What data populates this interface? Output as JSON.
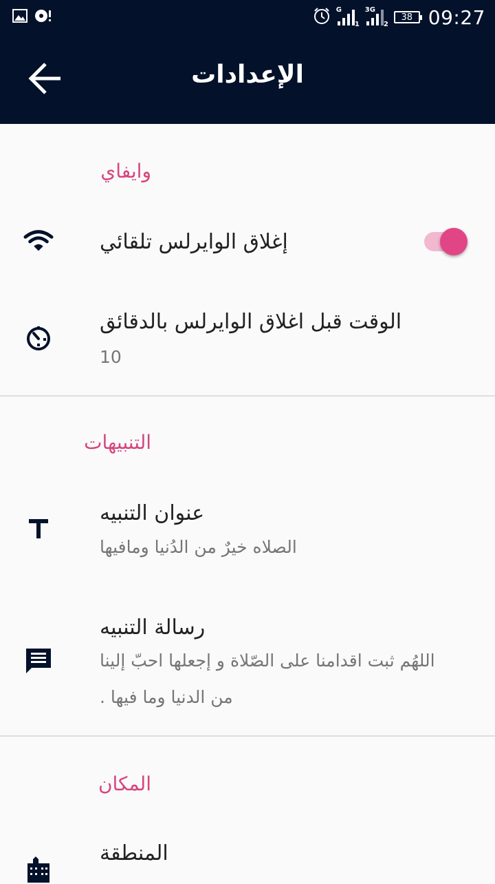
{
  "status_bar": {
    "time": "09:27",
    "battery": "38",
    "sim1_network": "G",
    "sim1_slot": "1",
    "sim2_network": "3G",
    "sim2_slot": "2",
    "icons": [
      "image-icon",
      "media-icon",
      "alarm-icon",
      "signal-icon",
      "battery-icon"
    ]
  },
  "app_bar": {
    "title": "الإعدادات",
    "back_icon": "arrow-back-icon"
  },
  "sections": {
    "wifi": {
      "title": "وايفاي",
      "auto_close": {
        "title": "إغلاق الوايرلس تلقائي",
        "icon": "wifi-icon",
        "enabled": true
      },
      "close_delay": {
        "title": "الوقت قبل اغلاق الوايرلس بالدقائق",
        "value": "10",
        "icon": "timer-icon"
      }
    },
    "notifications": {
      "title": "التنبيهات",
      "notif_title": {
        "title": "عنوان التنبيه",
        "value": "الصلاه خيرٌ من الدُنيا ومافيها",
        "icon": "text-icon"
      },
      "notif_message": {
        "title": "رسالة التنبيه",
        "value_line1": "اللهُم ثبت اقدامنا على الصّلاة و إجعلها احبّ إلينا",
        "value_line2": "من الدنيا وما فيها .",
        "icon": "message-icon"
      }
    },
    "location": {
      "title": "المكان",
      "region": {
        "title": "المنطقة",
        "icon": "city-icon"
      }
    }
  },
  "colors": {
    "primary_dark": "#03112a",
    "accent": "#e24585",
    "section_title": "#d6457e",
    "background": "#fafafa"
  }
}
